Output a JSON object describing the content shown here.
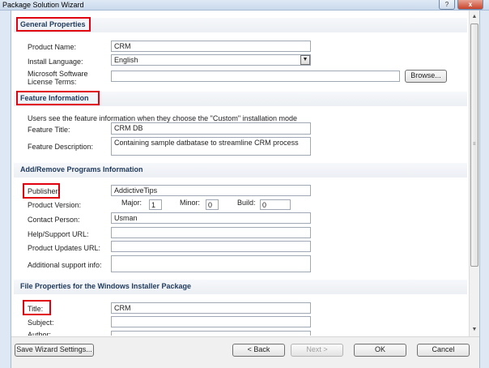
{
  "window": {
    "title": "Package Solution Wizard",
    "help": "?",
    "close": "x"
  },
  "sections": {
    "general": "General Properties",
    "feature": "Feature Information",
    "addremove": "Add/Remove Programs Information",
    "fileprops": "File Properties for the Windows Installer Package"
  },
  "general": {
    "product_name_label": "Product Name:",
    "product_name_value": "CRM",
    "install_language_label": "Install Language:",
    "install_language_value": "English",
    "license_label": "Microsoft Software License Terms:",
    "license_value": "",
    "browse_button": "Browse..."
  },
  "feature": {
    "note": "Users see the feature information when they choose the \"Custom\" installation mode",
    "title_label": "Feature Title:",
    "title_value": "CRM DB",
    "description_label": "Feature Description:",
    "description_value": "Containing sample datbatase to streamline CRM process"
  },
  "addremove": {
    "publisher_label": "Publisher:",
    "publisher_value": "AddictiveTips",
    "product_version_label": "Product Version:",
    "major_label": "Major:",
    "major_value": "1",
    "minor_label": "Minor:",
    "minor_value": "0",
    "build_label": "Build:",
    "build_value": "0",
    "contact_label": "Contact Person:",
    "contact_value": "Usman",
    "help_url_label": "Help/Support URL:",
    "help_url_value": "",
    "updates_url_label": "Product Updates URL:",
    "updates_url_value": "",
    "additional_label": "Additional support info:",
    "additional_value": ""
  },
  "fileprops": {
    "title_label": "Title:",
    "title_value": "CRM",
    "subject_label": "Subject:",
    "subject_value": "",
    "author_label": "Author:"
  },
  "footer": {
    "save_settings": "Save Wizard Settings...",
    "back": "< Back",
    "next": "Next >",
    "ok": "OK",
    "cancel": "Cancel"
  },
  "icons": {
    "dropdown": "▼",
    "scroll_up": "▲",
    "scroll_down": "▼",
    "grip": "≡"
  },
  "colors": {
    "highlight": "#e0000f",
    "section_text": "#1e395b"
  }
}
